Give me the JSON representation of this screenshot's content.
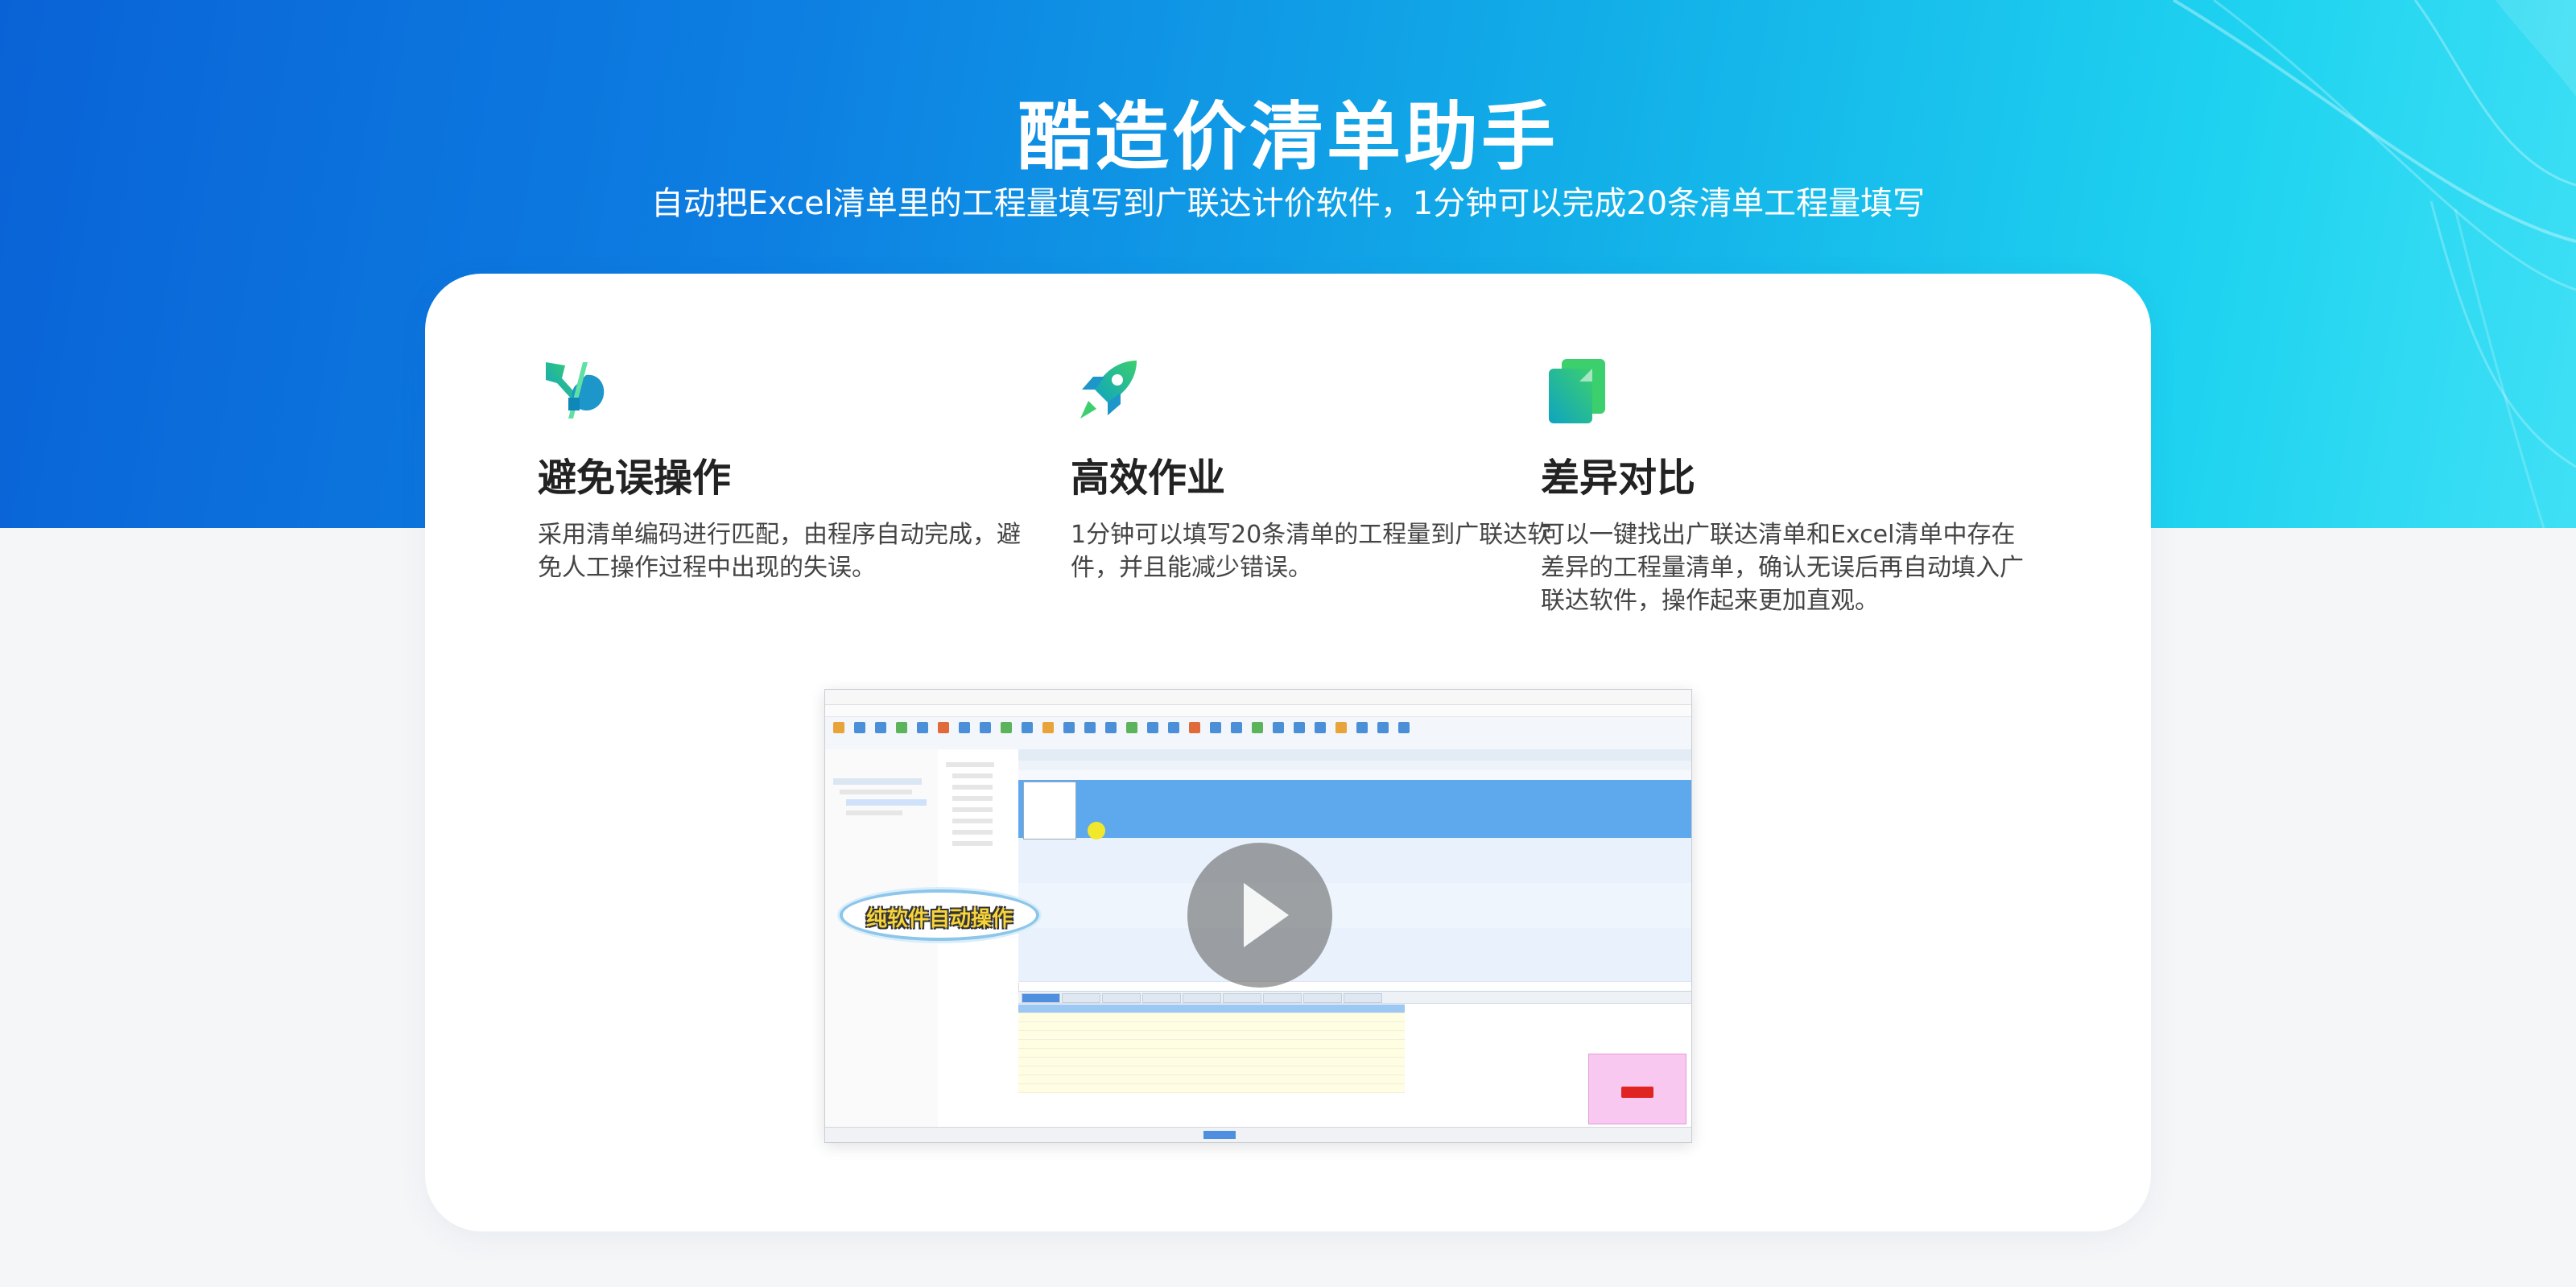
{
  "hero": {
    "title": "酷造价清单助手",
    "subtitle": "自动把Excel清单里的工程量填写到广联达计价软件，1分钟可以完成20条清单工程量填写"
  },
  "features": [
    {
      "icon": "tools-icon",
      "title": "避免误操作",
      "desc": "采用清单编码进行匹配，由程序自动完成，避免人工操作过程中出现的失误。"
    },
    {
      "icon": "rocket-icon",
      "title": "高效作业",
      "desc": "1分钟可以填写20条清单的工程量到广联达软件，并且能减少错误。"
    },
    {
      "icon": "documents-icon",
      "title": "差异对比",
      "desc": "可以一键找出广联达清单和Excel清单中存在差异的工程量清单，确认无误后再自动填入广联达软件，操作起来更加直观。"
    }
  ],
  "video": {
    "bubble_text": "纯软件自动操作"
  },
  "colors": {
    "hero_start": "#0a63d6",
    "hero_end": "#3fe0f5",
    "icon_start": "#0fa3c2",
    "icon_end": "#3ccf6e",
    "title_text": "#222222"
  }
}
